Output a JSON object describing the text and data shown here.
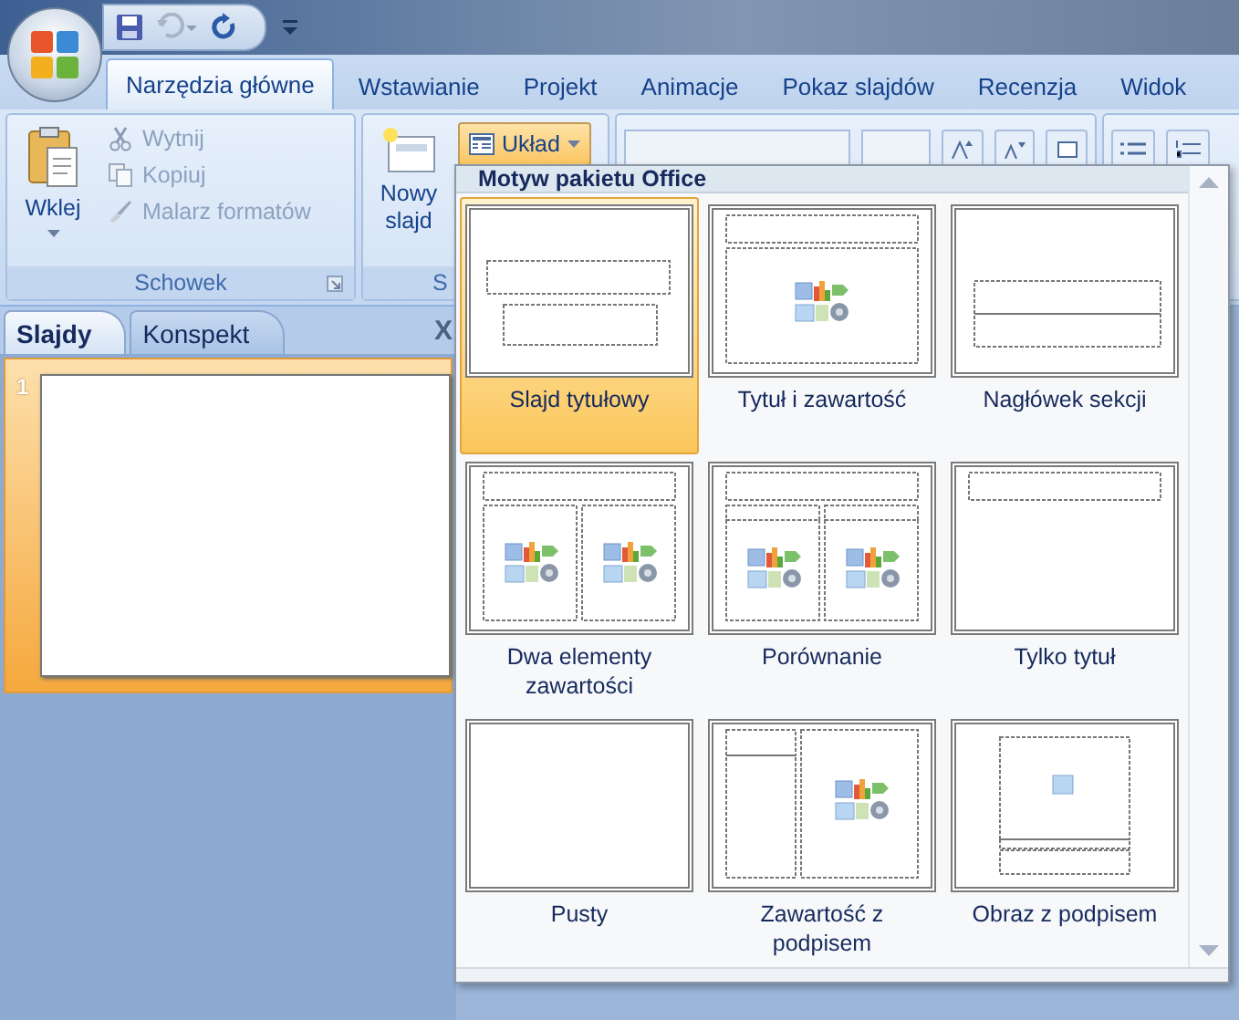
{
  "quick_access": {
    "undo_disabled": true
  },
  "tabs": [
    {
      "label": "Narzędzia główne",
      "selected": true
    },
    {
      "label": "Wstawianie",
      "selected": false
    },
    {
      "label": "Projekt",
      "selected": false
    },
    {
      "label": "Animacje",
      "selected": false
    },
    {
      "label": "Pokaz slajdów",
      "selected": false
    },
    {
      "label": "Recenzja",
      "selected": false
    },
    {
      "label": "Widok",
      "selected": false
    }
  ],
  "clipboard": {
    "paste": "Wklej",
    "group_label": "Schowek",
    "actions": [
      {
        "label": "Wytnij",
        "kind": "cut",
        "disabled": true
      },
      {
        "label": "Kopiuj",
        "kind": "copy",
        "disabled": true
      },
      {
        "label": "Malarz formatów",
        "kind": "painter",
        "disabled": true
      }
    ]
  },
  "slides_group": {
    "new_slide": "Nowy slajd",
    "layout": {
      "label": "Układ",
      "expanded": true
    },
    "group_label": "S"
  },
  "pane": {
    "tabs": [
      {
        "label": "Slajdy",
        "selected": true
      },
      {
        "label": "Konspekt",
        "selected": false
      }
    ],
    "close": "X",
    "slides": [
      {
        "number": "1",
        "selected": true
      }
    ]
  },
  "layout_menu": {
    "title": "Motyw pakietu Office",
    "layouts": [
      {
        "label": "Slajd tytułowy",
        "kind": "title",
        "selected": true
      },
      {
        "label": "Tytuł i zawartość",
        "kind": "title-content",
        "selected": false
      },
      {
        "label": "Nagłówek sekcji",
        "kind": "section",
        "selected": false
      },
      {
        "label": "Dwa elementy zawartości",
        "kind": "two-content",
        "selected": false
      },
      {
        "label": "Porównanie",
        "kind": "comparison",
        "selected": false
      },
      {
        "label": "Tylko tytuł",
        "kind": "title-only",
        "selected": false
      },
      {
        "label": "Pusty",
        "kind": "blank",
        "selected": false
      },
      {
        "label": "Zawartość z podpisem",
        "kind": "content-caption",
        "selected": false
      },
      {
        "label": "Obraz z podpisem",
        "kind": "picture-caption",
        "selected": false
      }
    ]
  }
}
